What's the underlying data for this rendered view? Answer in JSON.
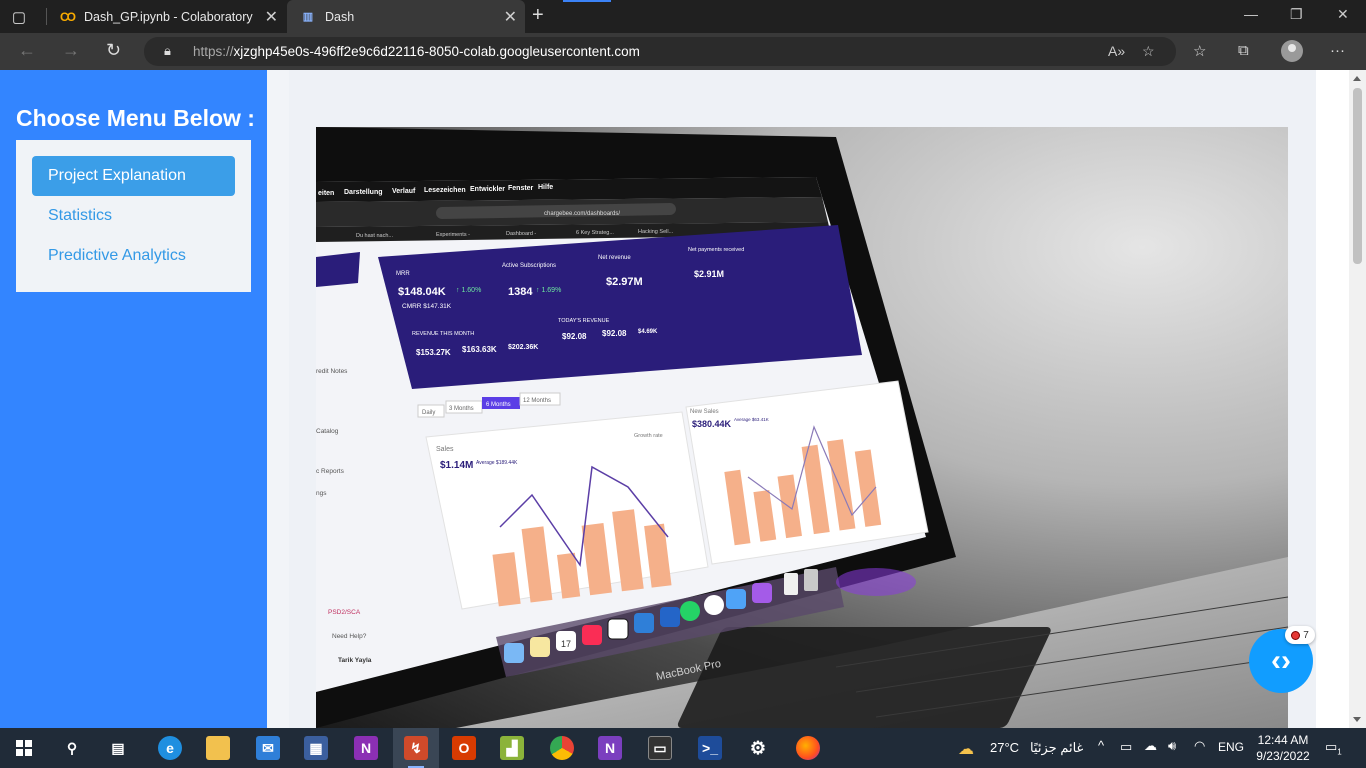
{
  "browser": {
    "tabs": [
      {
        "title": "Dash_GP.ipynb - Colaboratory",
        "icon": "colab-icon"
      },
      {
        "title": "Dash",
        "icon": "dash-icon",
        "active": true
      }
    ],
    "url": {
      "scheme": "https://",
      "host": "xjzghp45e0s-496ff2e9c6d22116-8050-colab.googleusercontent.com"
    }
  },
  "sidebar": {
    "title": "Choose Menu Below :",
    "items": [
      {
        "label": "Project Explanation",
        "active": true
      },
      {
        "label": "Statistics",
        "active": false
      },
      {
        "label": "Predictive Analytics",
        "active": false
      }
    ]
  },
  "hero": {
    "browser_url": "chargebee.com/dashboards/",
    "menu": [
      "eiten",
      "Darstellung",
      "Verlauf",
      "Lesezeichen",
      "Entwickler",
      "Fenster",
      "Hilfe"
    ],
    "bookmarks": [
      "Du hast nach...",
      "Experiments -",
      "Dashboard -",
      "6 Key Strateg...",
      "Hacking Sell..."
    ],
    "kpis": [
      {
        "label": "MRR",
        "value": "$148.04K",
        "delta": "↑ 1.60%",
        "sub": "CMRR  $147.31K"
      },
      {
        "label": "Active Subscriptions",
        "value": "1384",
        "delta": "↑ 1.69%"
      },
      {
        "label": "Net revenue",
        "value": "$2.97M"
      },
      {
        "label": "Net payments received",
        "value": "$2.91M"
      }
    ],
    "revenue_this_month": {
      "label": "REVENUE THIS MONTH",
      "items": [
        {
          "v": "$153.27K",
          "l": "Expected"
        },
        {
          "v": "$163.63K",
          "l": "Received"
        },
        {
          "v": "$202.36K",
          "l": "Last month"
        }
      ]
    },
    "todays_revenue": {
      "label": "TODAY'S REVENUE",
      "items": [
        {
          "v": "$92.08",
          "l": "Expected"
        },
        {
          "v": "$92.08",
          "l": "Received"
        },
        {
          "v": "$4.69K",
          "l": "Yesterday"
        }
      ]
    },
    "ranges": [
      "Daily",
      "3 Months",
      "6 Months",
      "12 Months"
    ],
    "sales": {
      "title": "Sales",
      "value": "$1.14M",
      "avg": "Average $189.44K",
      "legend": "Growth rate",
      "months": [
        "Jul",
        "Aug",
        "Sep",
        "Oct",
        "Nov",
        "Dec"
      ]
    },
    "new_sales": {
      "title": "New Sales",
      "value": "$380.44K",
      "avg": "Average $63.41K"
    },
    "side_nav": [
      "redit Notes",
      "Catalog",
      "c Reports",
      "ngs",
      "PSD2/SCA",
      "Need Help?",
      "Tarik Yayla"
    ],
    "laptop_brand": "MacBook Pro",
    "calendar_day": "17"
  },
  "debug": {
    "badge_count": "7"
  },
  "taskbar": {
    "weather": "27°C",
    "weather_desc": "غائم جزئيًا",
    "lang": "ENG",
    "time": "12:44 AM",
    "date": "9/23/2022",
    "notifications": "1"
  }
}
